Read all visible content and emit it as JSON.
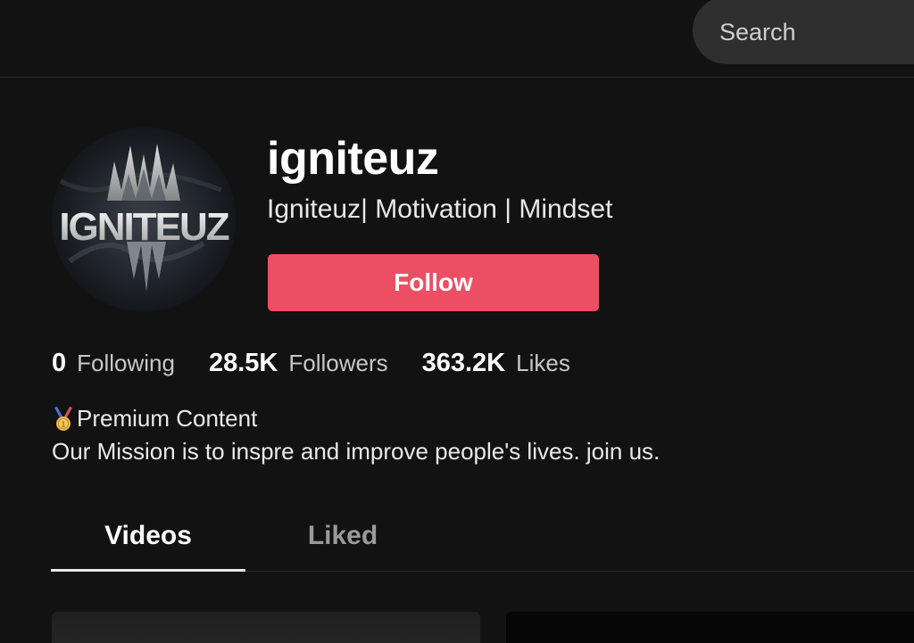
{
  "search": {
    "placeholder": "Search"
  },
  "profile": {
    "avatar_icon": "igniteuz-logo",
    "avatar_text": "IGNITEUZ",
    "username": "igniteuz",
    "subtitle": "Igniteuz| Motivation | Mindset",
    "follow_label": "Follow",
    "follow_color": "#ec4f64"
  },
  "stats": [
    {
      "value": "0",
      "label": "Following"
    },
    {
      "value": "28.5K",
      "label": "Followers"
    },
    {
      "value": "363.2K",
      "label": "Likes"
    }
  ],
  "bio": {
    "line1_icon": "medal-icon",
    "line1": "Premium Content",
    "line2": "Our Mission is to inspre and improve people's lives. join us."
  },
  "tabs": [
    {
      "label": "Videos",
      "active": true
    },
    {
      "label": "Liked",
      "active": false
    }
  ],
  "colors": {
    "background": "#121212",
    "accent": "#ec4f64",
    "muted_text": "#9a9a9a"
  }
}
